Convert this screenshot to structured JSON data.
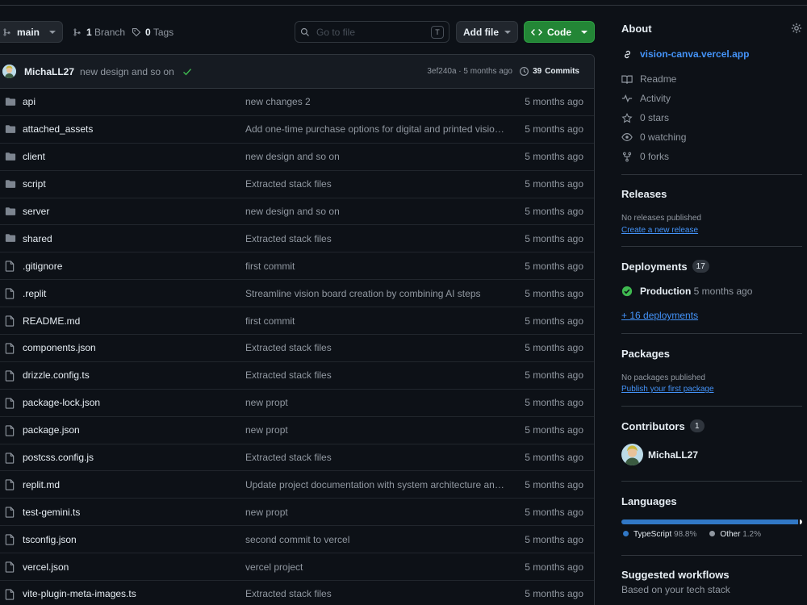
{
  "toolbar": {
    "branch_name": "main",
    "branch_count": "1",
    "branch_label": "Branch",
    "tag_count": "0",
    "tag_label": "Tags",
    "search_placeholder": "Go to file",
    "search_shortcut": "T",
    "add_file_label": "Add file",
    "code_label": "Code"
  },
  "commit": {
    "author": "MichaLL27",
    "message": "new design and so on",
    "hash_time": "3ef240a · 5 months ago",
    "commits_count": "39",
    "commits_label": "Commits"
  },
  "files": [
    {
      "type": "dir",
      "name": "api",
      "message": "new changes 2",
      "date": "5 months ago"
    },
    {
      "type": "dir",
      "name": "attached_assets",
      "message": "Add one-time purchase options for digital and printed vision …",
      "date": "5 months ago"
    },
    {
      "type": "dir",
      "name": "client",
      "message": "new design and so on",
      "date": "5 months ago"
    },
    {
      "type": "dir",
      "name": "script",
      "message": "Extracted stack files",
      "date": "5 months ago"
    },
    {
      "type": "dir",
      "name": "server",
      "message": "new design and so on",
      "date": "5 months ago"
    },
    {
      "type": "dir",
      "name": "shared",
      "message": "Extracted stack files",
      "date": "5 months ago"
    },
    {
      "type": "file",
      "name": ".gitignore",
      "message": "first commit",
      "date": "5 months ago"
    },
    {
      "type": "file",
      "name": ".replit",
      "message": "Streamline vision board creation by combining AI steps",
      "date": "5 months ago"
    },
    {
      "type": "file",
      "name": "README.md",
      "message": "first commit",
      "date": "5 months ago"
    },
    {
      "type": "file",
      "name": "components.json",
      "message": "Extracted stack files",
      "date": "5 months ago"
    },
    {
      "type": "file",
      "name": "drizzle.config.ts",
      "message": "Extracted stack files",
      "date": "5 months ago"
    },
    {
      "type": "file",
      "name": "package-lock.json",
      "message": "new propt",
      "date": "5 months ago"
    },
    {
      "type": "file",
      "name": "package.json",
      "message": "new propt",
      "date": "5 months ago"
    },
    {
      "type": "file",
      "name": "postcss.config.js",
      "message": "Extracted stack files",
      "date": "5 months ago"
    },
    {
      "type": "file",
      "name": "replit.md",
      "message": "Update project documentation with system architecture and …",
      "date": "5 months ago"
    },
    {
      "type": "file",
      "name": "test-gemini.ts",
      "message": "new propt",
      "date": "5 months ago"
    },
    {
      "type": "file",
      "name": "tsconfig.json",
      "message": "second commit to vercel",
      "date": "5 months ago"
    },
    {
      "type": "file",
      "name": "vercel.json",
      "message": "vercel project",
      "date": "5 months ago"
    },
    {
      "type": "file",
      "name": "vite-plugin-meta-images.ts",
      "message": "Extracted stack files",
      "date": "5 months ago"
    }
  ],
  "about": {
    "heading": "About",
    "website": "vision-canva.vercel.app",
    "readme": "Readme",
    "activity": "Activity",
    "stars": "0 stars",
    "watching": "0 watching",
    "forks": "0 forks"
  },
  "releases": {
    "heading": "Releases",
    "empty": "No releases published",
    "create_link": "Create a new release"
  },
  "deployments": {
    "heading": "Deployments",
    "count": "17",
    "env_name": "Production",
    "env_time": "5 months ago",
    "more_link": "+ 16 deployments"
  },
  "packages": {
    "heading": "Packages",
    "empty": "No packages published",
    "publish_link": "Publish your first package"
  },
  "contributors": {
    "heading": "Contributors",
    "count": "1",
    "name": "MichaLL27"
  },
  "languages": {
    "heading": "Languages",
    "items": [
      {
        "name": "TypeScript",
        "percent": "98.8%",
        "value": 98.8,
        "color": "#3178c6"
      },
      {
        "name": "Other",
        "percent": "1.2%",
        "value": 1.2,
        "color": "#ededed"
      }
    ]
  },
  "workflows": {
    "heading": "Suggested workflows",
    "subtitle": "Based on your tech stack"
  },
  "colors": {
    "background": "#0d1117",
    "border": "#30363d",
    "accent_link": "#4493f8",
    "code_button": "#238636",
    "success": "#3fb950"
  }
}
